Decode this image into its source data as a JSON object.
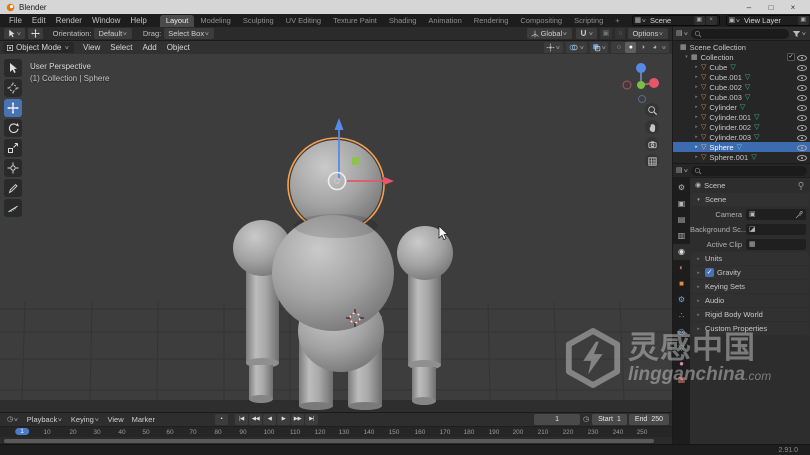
{
  "window": {
    "title": "Blender"
  },
  "topbar": {
    "menus": [
      "File",
      "Edit",
      "Render",
      "Window",
      "Help"
    ],
    "workspaces": [
      "Layout",
      "Modeling",
      "Sculpting",
      "UV Editing",
      "Texture Paint",
      "Shading",
      "Animation",
      "Rendering",
      "Compositing",
      "Scripting"
    ],
    "active_workspace": "Layout",
    "add_tab": "+",
    "scene_selector": "Scene",
    "view_layer_selector": "View Layer"
  },
  "tool_settings": {
    "orientation_label": "Orientation:",
    "orientation_value": "Default",
    "drag_label": "Drag:",
    "drag_value": "Select Box",
    "transform_space": "Global",
    "options_label": "Options"
  },
  "viewport": {
    "mode": "Object Mode",
    "menus": [
      "View",
      "Select",
      "Add",
      "Object"
    ],
    "overlay_line1": "User Perspective",
    "overlay_line2": "(1) Collection | Sphere",
    "tools": [
      "select-box",
      "cursor",
      "move",
      "rotate",
      "scale",
      "transform",
      "annotate",
      "measure"
    ],
    "active_tool": "move"
  },
  "outliner": {
    "root": "Scene Collection",
    "collection": "Collection",
    "items": [
      "Cube",
      "Cube.001",
      "Cube.002",
      "Cube.003",
      "Cylinder",
      "Cylinder.001",
      "Cylinder.002",
      "Cylinder.003",
      "Sphere",
      "Sphere.001"
    ],
    "selected": "Sphere"
  },
  "properties": {
    "breadcrumb": "Scene",
    "section": "Scene",
    "fields": [
      {
        "label": "Camera",
        "glyph": "▣",
        "value": ""
      },
      {
        "label": "Background Sc...",
        "glyph": "◪",
        "value": ""
      },
      {
        "label": "Active Clip",
        "glyph": "▦",
        "value": ""
      }
    ],
    "panels": [
      "Units",
      "Gravity",
      "Keying Sets",
      "Audio",
      "Rigid Body World",
      "Custom Properties"
    ],
    "gravity_on": true,
    "tabs": [
      {
        "name": "tool",
        "glyph": "⚙",
        "color": "#b4b4b4"
      },
      {
        "name": "render",
        "glyph": "▣",
        "color": "#b4b4b4"
      },
      {
        "name": "output",
        "glyph": "▤",
        "color": "#b4b4b4"
      },
      {
        "name": "view-layer",
        "glyph": "▥",
        "color": "#b4b4b4"
      },
      {
        "name": "scene",
        "glyph": "◉",
        "color": "#e0e0e0"
      },
      {
        "name": "world",
        "glyph": "◐",
        "color": "#c07a6a"
      },
      {
        "name": "object",
        "glyph": "■",
        "color": "#e8883a"
      },
      {
        "name": "modifiers",
        "glyph": "⚙",
        "color": "#71a8e0"
      },
      {
        "name": "particles",
        "glyph": "∴",
        "color": "#c9a06a"
      },
      {
        "name": "physics",
        "glyph": "◎",
        "color": "#71a8e0"
      },
      {
        "name": "object-data",
        "glyph": "▽",
        "color": "#3dbf8f"
      },
      {
        "name": "material",
        "glyph": "●",
        "color": "#d98bb1"
      },
      {
        "name": "texture",
        "glyph": "▦",
        "color": "#c96a6a"
      }
    ]
  },
  "timeline": {
    "menus": [
      "Playback",
      "Keying",
      "View",
      "Marker"
    ],
    "current_frame": "1",
    "start_label": "Start",
    "start_value": "1",
    "end_label": "End",
    "end_value": "250",
    "ticks": [
      "1",
      "10",
      "20",
      "30",
      "40",
      "50",
      "60",
      "70",
      "80",
      "90",
      "100",
      "110",
      "120",
      "130",
      "140",
      "150",
      "160",
      "170",
      "180",
      "190",
      "200",
      "210",
      "220",
      "230",
      "240",
      "250"
    ]
  },
  "statusbar": {
    "version": "2.91.0"
  },
  "watermark": {
    "cjk": "灵感中国",
    "latin": "lingganchina",
    "tld": ".com"
  },
  "icons": {
    "chevron": "∨",
    "triangle_right": "▸",
    "triangle_down": "▾",
    "mesh": "▽",
    "collection": "▦",
    "editor": "▤",
    "scene_widget": "▦",
    "copy": "▣",
    "minimize": "–",
    "maximize": "□",
    "close": "×",
    "clock": "◷",
    "check": "✓",
    "proportional": "○",
    "record": "▪",
    "wire_circle": "○",
    "solid_circle": "●",
    "material_circle": "◑",
    "rendered_circle": "◕",
    "scene_breadcrumb": "◉",
    "transport": [
      "|◀",
      "◀◀",
      "◀",
      "▶",
      "▶▶",
      "▶|"
    ]
  },
  "colors": {
    "selection_blue": "#3d6bb0",
    "accent_blue": "#4772b3",
    "object_orange": "#e8883a",
    "mesh_green": "#3dbf8f",
    "axis_x_red": "#e8556a",
    "axis_z_blue": "#5689e8",
    "axis_y_green": "#7ac142",
    "gizmo_plane_green": "#8bc34a",
    "selected_outline_orange": "#f5a14b"
  }
}
